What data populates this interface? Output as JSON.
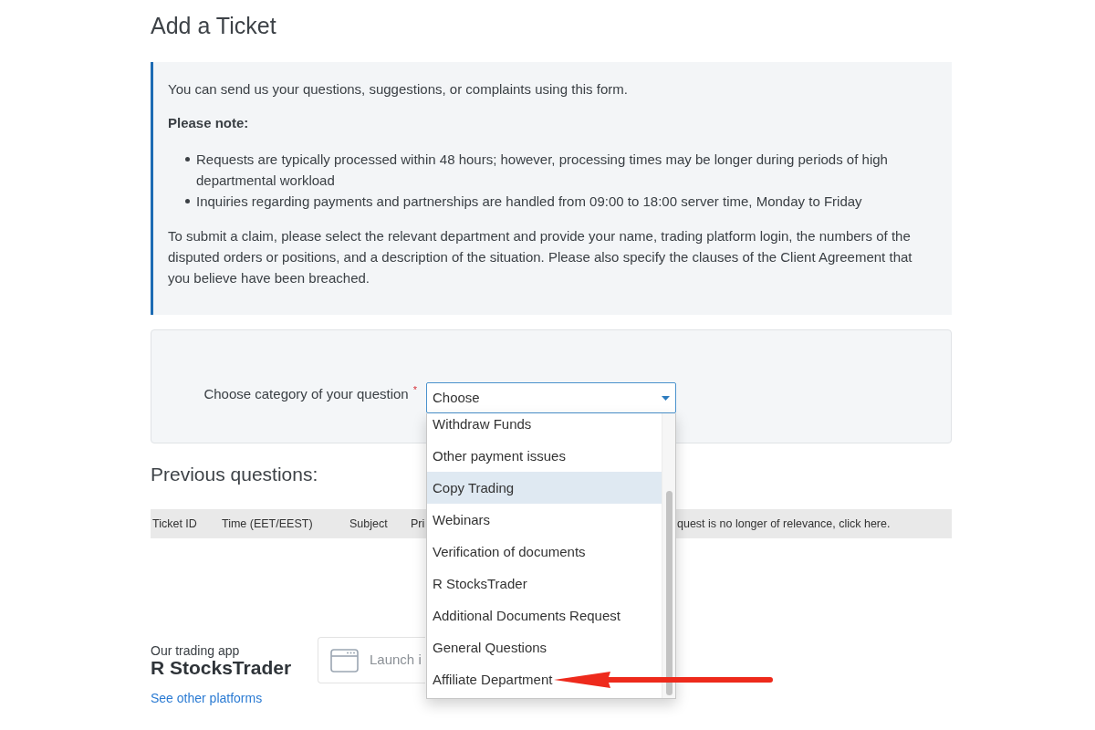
{
  "page": {
    "title": "Add a Ticket"
  },
  "notice": {
    "intro": "You can send us your questions, suggestions, or complaints using this form.",
    "heading": "Please note:",
    "bullets": [
      "Requests are typically processed within 48 hours; however, processing times may be longer during periods of high departmental workload",
      "Inquiries regarding payments and partnerships are handled from 09:00 to 18:00 server time, Monday to Friday"
    ],
    "closing": "To submit a claim, please select the relevant department and provide your name, trading platform login, the numbers of the disputed orders or positions, and a description of the situation. Please also specify the clauses of the Client Agreement that you believe have been breached."
  },
  "category_form": {
    "label": "Choose category of your question",
    "required_mark": "*",
    "select": {
      "value": "Choose",
      "expanded": true
    },
    "options": [
      {
        "label": "Withdraw Funds",
        "selected": false,
        "arrow": false
      },
      {
        "label": "Other payment issues",
        "selected": false,
        "arrow": false
      },
      {
        "label": "Copy Trading",
        "selected": true,
        "arrow": false
      },
      {
        "label": "Webinars",
        "selected": false,
        "arrow": false
      },
      {
        "label": "Verification of documents",
        "selected": false,
        "arrow": false
      },
      {
        "label": "R StocksTrader",
        "selected": false,
        "arrow": false
      },
      {
        "label": "Additional Documents Request",
        "selected": false,
        "arrow": false
      },
      {
        "label": "General Questions",
        "selected": false,
        "arrow": false
      },
      {
        "label": "Affiliate Department",
        "selected": false,
        "arrow": true
      }
    ]
  },
  "previous_questions": {
    "title": "Previous questions:",
    "columns": [
      "Ticket ID",
      "Time (EET/EEST)",
      "Subject",
      "Pri",
      "quest is no longer of relevance, click here."
    ]
  },
  "app_promo": {
    "caption": "Our trading app",
    "name": "R StocksTrader",
    "launch_button": "Launch i",
    "link": "See other platforms"
  }
}
